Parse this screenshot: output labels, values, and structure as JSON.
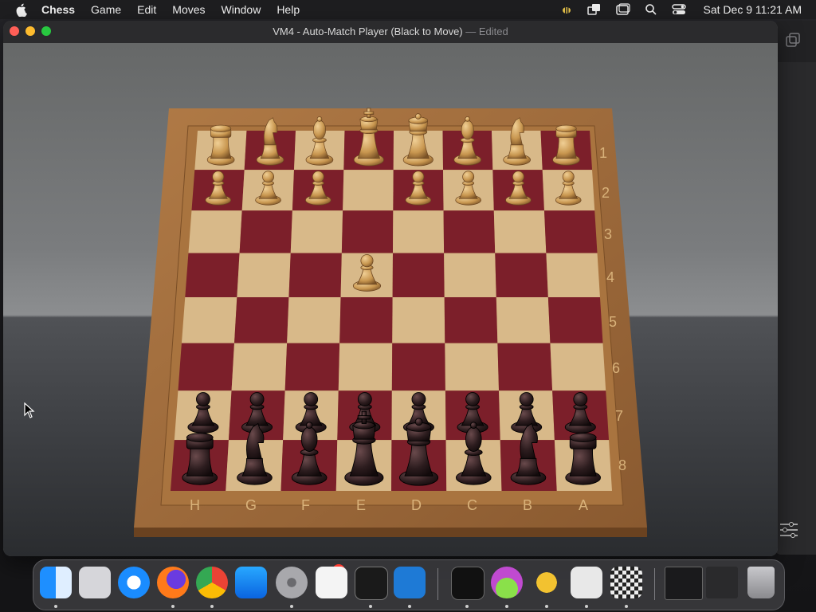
{
  "menubar": {
    "app_name": "Chess",
    "items": [
      "Game",
      "Edit",
      "Moves",
      "Window",
      "Help"
    ],
    "clock": "Sat Dec 9  11:21 AM"
  },
  "window": {
    "title": "VM4 - Auto-Match Player  (Black to Move)",
    "separator": "—",
    "edited": "Edited"
  },
  "board": {
    "rank_labels": [
      "1",
      "2",
      "3",
      "4",
      "5",
      "6",
      "7",
      "8"
    ],
    "file_labels": [
      "H",
      "G",
      "F",
      "E",
      "D",
      "C",
      "B",
      "A"
    ],
    "colors": {
      "light_square": "#d8b989",
      "dark_square": "#7c1f2a",
      "frame": "#9a6a3c",
      "white_piece": "#c89a5a",
      "black_piece": "#2a1a1c"
    }
  },
  "dock": {
    "apps": [
      "finder-icon",
      "launchpad-icon",
      "safari-icon",
      "firefox-icon",
      "chrome-icon",
      "app-store-icon",
      "system-settings-icon",
      "textedit-icon",
      "terminal-icon",
      "vscode-icon",
      "activity-monitor-icon",
      "potion-icon",
      "bee-icon",
      "disk-utility-icon",
      "chess-icon",
      "window-preview-icon",
      "window-preview-icon-2",
      "trash-icon"
    ],
    "settings_badge": "1"
  }
}
